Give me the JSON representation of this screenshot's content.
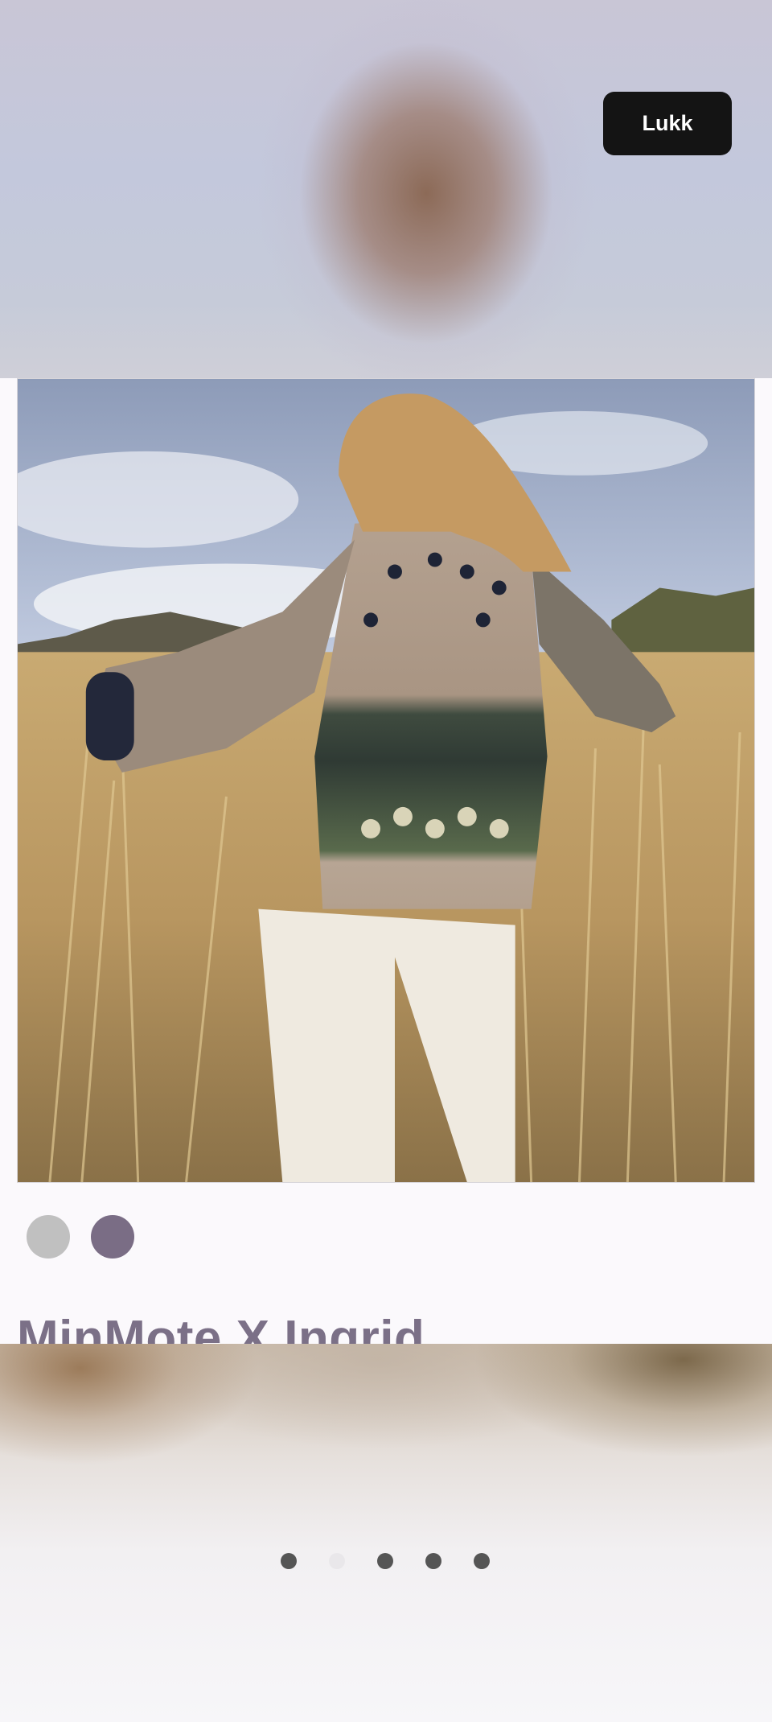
{
  "close_button": {
    "label": "Lukk"
  },
  "product": {
    "title": "MinMote X Ingrid"
  },
  "color_options": [
    {
      "name": "grey",
      "color": "#c0c0c0"
    },
    {
      "name": "purple",
      "color": "#7a6d85"
    }
  ],
  "gallery": {
    "dot_count": 5,
    "active_index": 1
  },
  "colors": {
    "button_bg": "#141414",
    "title": "#7b7087",
    "dot": "#555555",
    "dot_active": "#e9e7ea",
    "page_bg": "#fbf9fc"
  }
}
